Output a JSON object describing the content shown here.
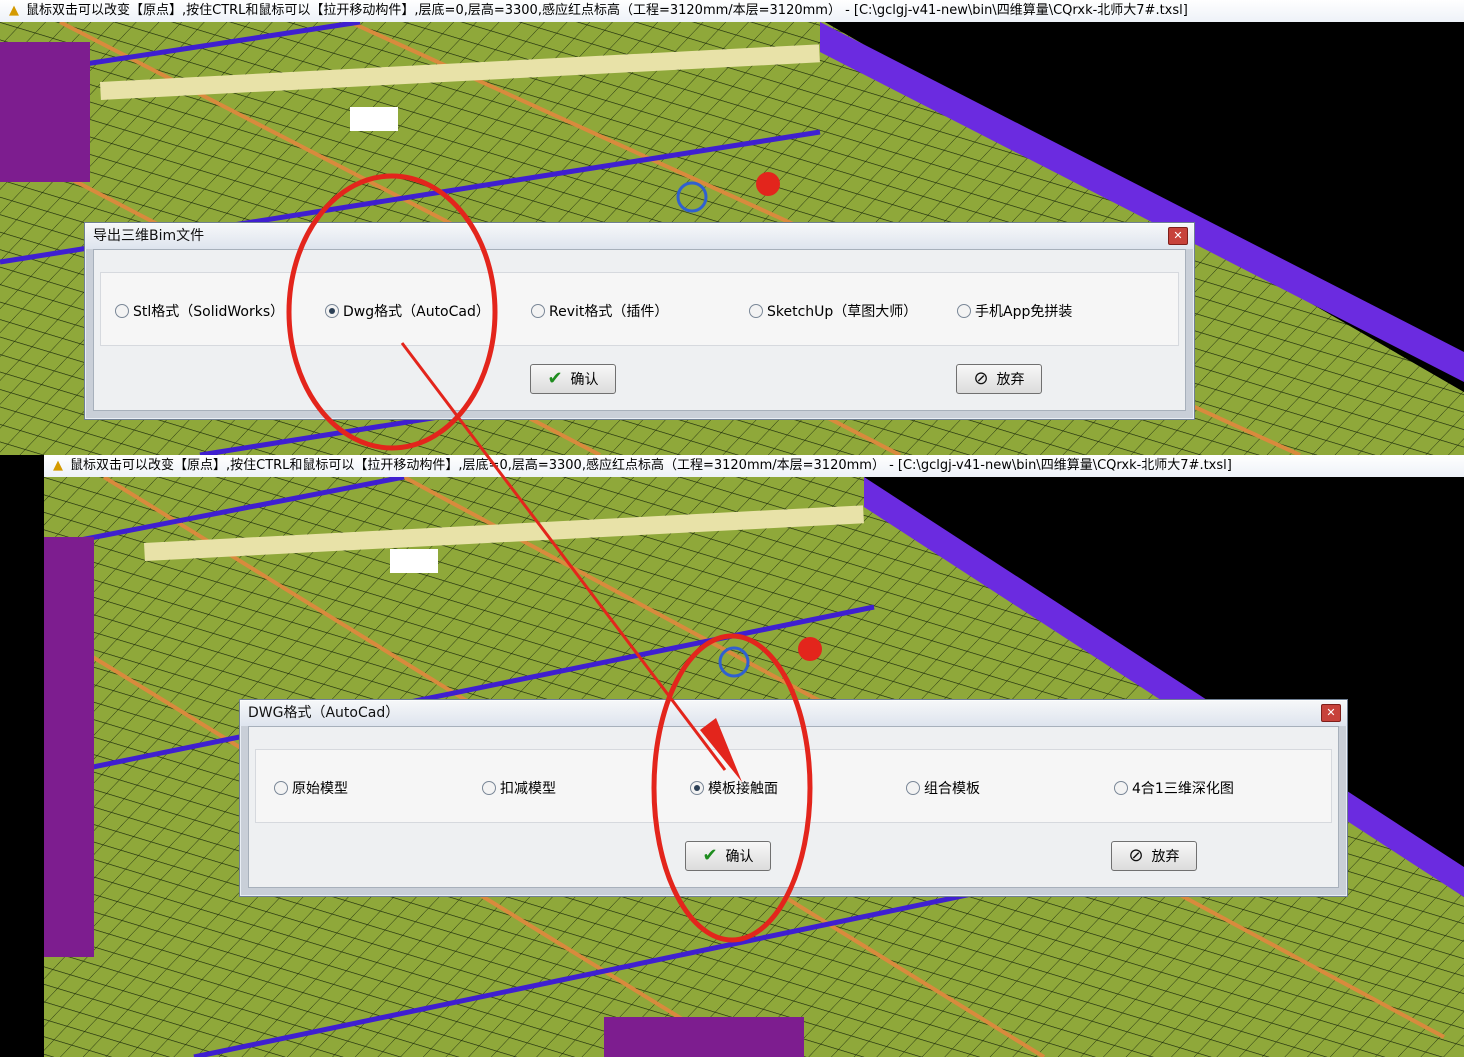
{
  "window": {
    "title": "鼠标双击可以改变【原点】,按住CTRL和鼠标可以【拉开移动构件】,层底=0,层高=3300,感应红点标高（工程=3120mm/本层=3120mm） - [C:\\gclgj-v41-new\\bin\\四维算量\\CQrxk-北师大7#.txsl]"
  },
  "dialog1": {
    "title": "导出三维Bim文件",
    "options": [
      {
        "label": "Stl格式（SolidWorks）",
        "checked": false
      },
      {
        "label": "Dwg格式（AutoCad）",
        "checked": true
      },
      {
        "label": "Revit格式（插件）",
        "checked": false
      },
      {
        "label": "SketchUp（草图大师）",
        "checked": false
      },
      {
        "label": "手机App免拼装",
        "checked": false
      }
    ],
    "ok_label": "确认",
    "cancel_label": "放弃"
  },
  "dialog2": {
    "title": "DWG格式（AutoCad）",
    "options": [
      {
        "label": "原始模型",
        "checked": false
      },
      {
        "label": "扣减模型",
        "checked": false
      },
      {
        "label": "模板接触面",
        "checked": true
      },
      {
        "label": "组合模板",
        "checked": false
      },
      {
        "label": "4合1三维深化图",
        "checked": false
      }
    ],
    "ok_label": "确认",
    "cancel_label": "放弃"
  },
  "colors": {
    "annotation": "#e3251c",
    "slab": "#8fa83a",
    "beam": "#d98a3d",
    "wall": "#6b2be0"
  }
}
